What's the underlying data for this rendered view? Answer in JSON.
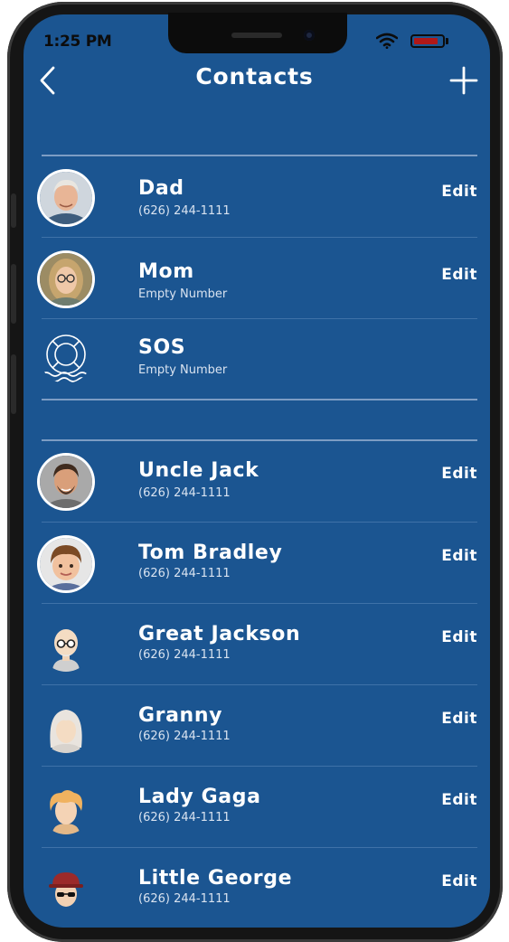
{
  "status_bar": {
    "time": "1:25 PM",
    "battery_color": "#b01818"
  },
  "nav": {
    "title": "Contacts",
    "back_icon": "chevron-left-icon",
    "add_icon": "plus-icon"
  },
  "theme": {
    "background": "#1b5591",
    "divider": "#7d9dc4",
    "text": "#ffffff"
  },
  "emergency_contacts": [
    {
      "name": "Dad",
      "number": "(626) 244-1111",
      "edit_label": "Edit",
      "avatar": "dad-avatar"
    },
    {
      "name": "Mom",
      "number": "Empty Number",
      "edit_label": "Edit",
      "avatar": "mom-avatar"
    },
    {
      "name": "SOS",
      "number": "Empty Number",
      "avatar": "lifebuoy-icon"
    }
  ],
  "contacts": [
    {
      "name": "Uncle Jack",
      "number": "(626) 244-1111",
      "edit_label": "Edit",
      "avatar": "uncle-jack-avatar"
    },
    {
      "name": "Tom Bradley",
      "number": "(626) 244-1111",
      "edit_label": "Edit",
      "avatar": "tom-bradley-avatar"
    },
    {
      "name": "Great Jackson",
      "number": "(626) 244-1111",
      "edit_label": "Edit",
      "avatar": "great-jackson-avatar"
    },
    {
      "name": "Granny",
      "number": "(626) 244-1111",
      "edit_label": "Edit",
      "avatar": "granny-avatar"
    },
    {
      "name": "Lady Gaga",
      "number": "(626) 244-1111",
      "edit_label": "Edit",
      "avatar": "lady-gaga-avatar"
    },
    {
      "name": "Little George",
      "number": "(626) 244-1111",
      "edit_label": "Edit",
      "avatar": "little-george-avatar"
    }
  ]
}
